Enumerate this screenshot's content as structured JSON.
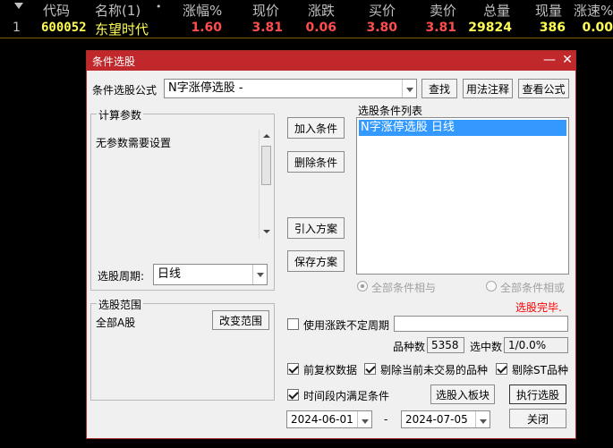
{
  "grid": {
    "headers": [
      "代码",
      "名称(1)",
      "•",
      "涨幅%",
      "现价",
      "涨跌",
      "买价",
      "卖价",
      "总量",
      "现量",
      "涨速%"
    ],
    "row": {
      "index": "1",
      "code": "600052",
      "name": "东望时代",
      "change_pct": "1.60",
      "price": "3.81",
      "change": "0.06",
      "bid": "3.80",
      "ask": "3.81",
      "volume": "29824",
      "last_vol": "386",
      "speed": "0.00"
    }
  },
  "dialog": {
    "title": "条件选股",
    "formula_label": "条件选股公式",
    "formula_value": "N字涨停选股  -",
    "find_button": "查找",
    "usage_button": "用法注释",
    "view_formula_button": "查看公式",
    "params_group": "计算参数",
    "params_text": "无参数需要设置",
    "period_label": "选股周期:",
    "period_value": "日线",
    "add_condition": "加入条件",
    "delete_condition": "删除条件",
    "import_plan": "引入方案",
    "save_plan": "保存方案",
    "list_title": "选股条件列表",
    "list_items": [
      "N字涨停选股  日线"
    ],
    "radio_and": "全部条件相与",
    "radio_or": "全部条件相或",
    "status": "选股完毕.",
    "scope_group": "选股范围",
    "scope_text": "全部A股",
    "change_scope": "改变范围",
    "use_irregular_label": "使用涨跌不定周期",
    "count_label": "品种数",
    "count_value": "5358",
    "selected_label": "选中数",
    "selected_value": "1/0.0%",
    "fq_label": "前复权数据",
    "exclude_untraded": "剔除当前未交易的品种",
    "exclude_st": "剔除ST品种",
    "time_range_label": "时间段内满足条件",
    "to_block": "选股入板块",
    "execute": "执行选股",
    "start_date": "2024-06-01",
    "date_sep": "-",
    "end_date": "2024-07-05",
    "close": "关闭",
    "minimize_symbol": "—",
    "close_symbol": "✕"
  },
  "colors": {
    "up": "#ff4d4d",
    "name": "#ffff54",
    "code": "#ffff54",
    "titlebar": "#c0282b",
    "status": "#ff0000",
    "selection": "#3399ff"
  }
}
